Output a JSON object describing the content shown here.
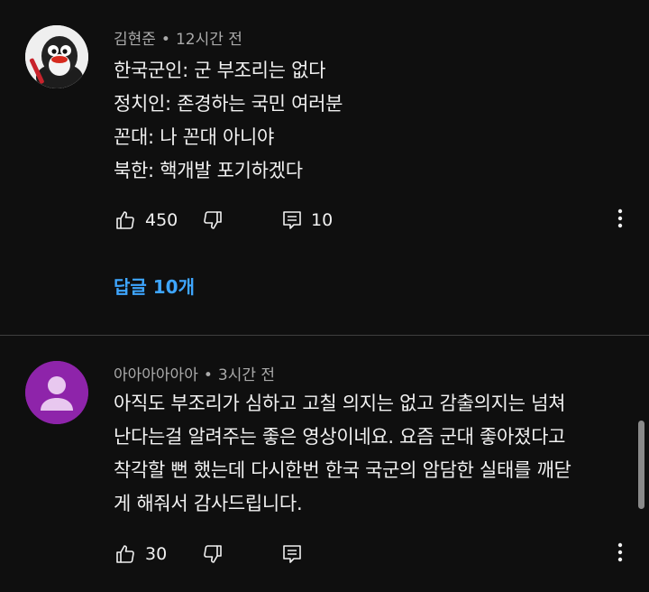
{
  "comments": [
    {
      "author": "김현준",
      "time": "12시간 전",
      "avatar_icon": "penguin-avatar",
      "lines": [
        "한국군인: 군 부조리는 없다",
        "정치인: 존경하는 국민 여러분",
        "꼰대: 나 꼰대 아니야",
        "북한: 핵개발 포기하겠다"
      ],
      "likes": "450",
      "reply_count": "10",
      "replies_link": "답글 10개"
    },
    {
      "author": "아아아아아아",
      "time": "3시간 전",
      "avatar_icon": "default-user-avatar",
      "avatar_color": "#8e24aa",
      "lines": [
        "아직도 부조리가 심하고 고칠 의지는 없고 감출의지는 넘쳐",
        "난다는걸 알려주는 좋은 영상이네요. 요즘 군대 좋아졌다고",
        "착각할 뻔 했는데 다시한번 한국 국군의 암담한 실태를 깨닫",
        "게 해줘서 감사드립니다."
      ],
      "likes": "30"
    }
  ],
  "meta_separator": "•",
  "colors": {
    "background": "#0f0f0f",
    "link": "#3ea6ff",
    "secondary_text": "#aaaaaa"
  }
}
